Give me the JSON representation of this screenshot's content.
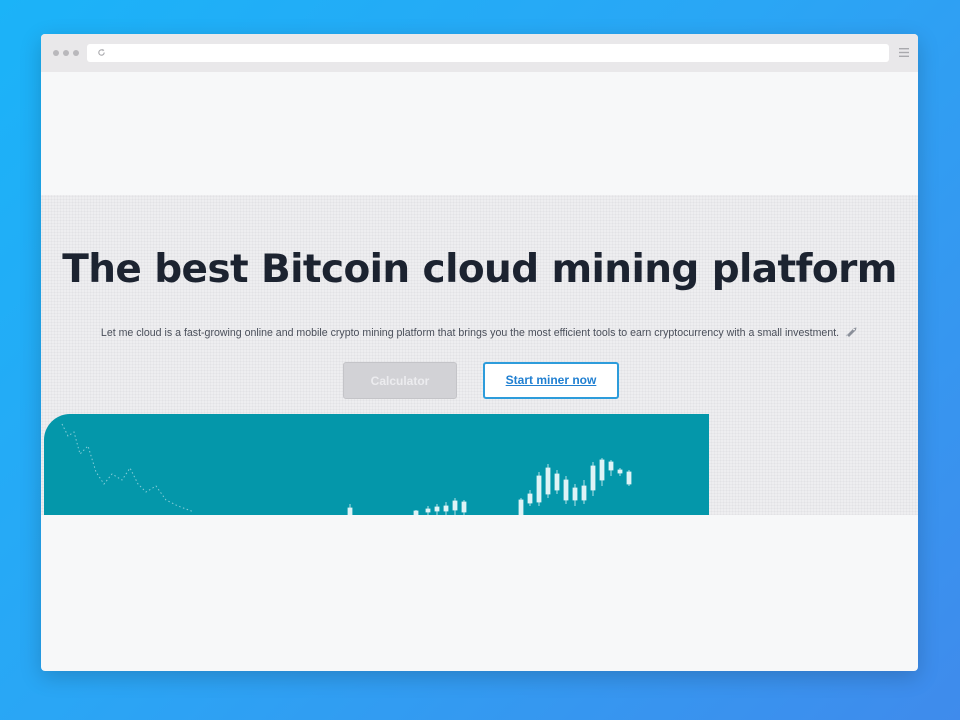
{
  "browser": {
    "url_text": "",
    "icons": {
      "reload": "reload-icon",
      "menu": "hamburger-menu-icon"
    }
  },
  "hero": {
    "headline": "The best Bitcoin cloud mining platform",
    "subtitle": "Let me cloud is a fast-growing online and mobile crypto mining platform that brings you the most efficient tools to earn cryptocurrency with a small investment.",
    "subtitle_icon": "rocket-icon",
    "calculator_label": "Calculator",
    "start_label": "Start miner now"
  },
  "colors": {
    "background_gradient_start": "#1bb3f8",
    "background_gradient_end": "#3f8bec",
    "chart_panel": "#0497aa",
    "headline": "#1c2330",
    "primary_button_border": "#2d9cdb"
  }
}
